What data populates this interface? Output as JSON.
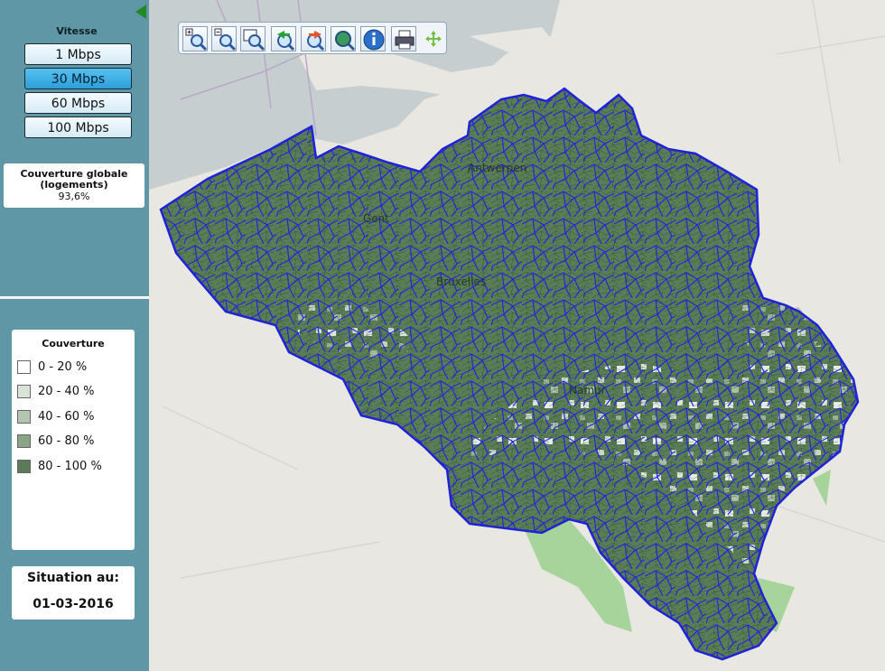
{
  "sidebar": {
    "speed_title": "Vitesse",
    "speed_buttons": [
      {
        "label": "1 Mbps",
        "active": false
      },
      {
        "label": "30 Mbps",
        "active": true
      },
      {
        "label": "60 Mbps",
        "active": false
      },
      {
        "label": "100 Mbps",
        "active": false
      }
    ],
    "global_coverage": {
      "title": "Couverture globale",
      "subtitle": "(logements)",
      "value": "93,6%"
    },
    "legend": {
      "title": "Couverture",
      "items": [
        {
          "label": "0 - 20 %",
          "color": "#ffffff"
        },
        {
          "label": "20 - 40 %",
          "color": "#d9e3d7"
        },
        {
          "label": "40 - 60 %",
          "color": "#b4c6b1"
        },
        {
          "label": "60 - 80 %",
          "color": "#8aa487"
        },
        {
          "label": "80 - 100 %",
          "color": "#5b7a58"
        }
      ]
    },
    "situation": {
      "label": "Situation au:",
      "date": "01-03-2016"
    }
  },
  "map": {
    "city_labels": [
      "Antwerpen",
      "Gent",
      "Bruxelles",
      "Namur"
    ],
    "border_color": "#1f22d6",
    "base_color": "#e9e7e1",
    "water_color": "#c7ced0",
    "forest_color": "#a7d49a"
  },
  "toolbar": {
    "tools": [
      "zoom-in-icon",
      "zoom-out-icon",
      "zoom-extent-icon",
      "pan-back-icon",
      "pan-forward-icon",
      "zoom-full-icon",
      "info-icon",
      "print-icon",
      "move-icon"
    ]
  }
}
